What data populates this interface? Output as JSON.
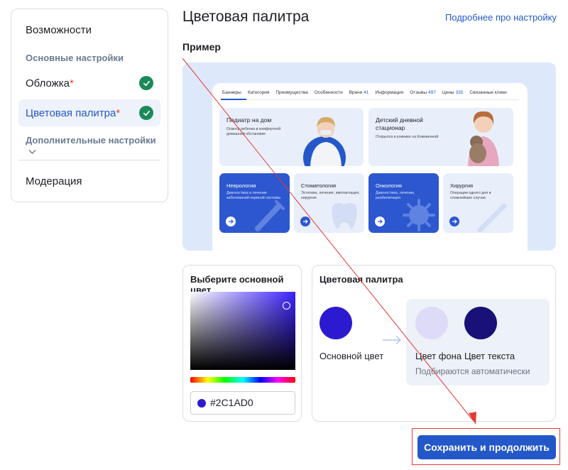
{
  "sidebar": {
    "features": "Возможности",
    "main_settings": "Основные настройки",
    "cover": "Обложка",
    "palette": "Цветовая палитра",
    "required_mark": "*",
    "additional": "Дополнительные настройки",
    "moderation": "Модерация"
  },
  "main": {
    "title": "Цветовая палитра",
    "more_link": "Подробнее про настройку",
    "example_heading": "Пример"
  },
  "preview": {
    "tabs": [
      {
        "label": "Баннеры",
        "count": ""
      },
      {
        "label": "Категория",
        "count": ""
      },
      {
        "label": "Преимущества",
        "count": ""
      },
      {
        "label": "Особенности",
        "count": ""
      },
      {
        "label": "Врачи",
        "count": "41"
      },
      {
        "label": "Информация",
        "count": ""
      },
      {
        "label": "Отзывы",
        "count": "497"
      },
      {
        "label": "Цены",
        "count": "335"
      },
      {
        "label": "Связанные клики",
        "count": ""
      }
    ],
    "banner1": {
      "title": "Педиатр на дом",
      "sub": "Осмотр ребенка в комфортной домашней обстановке"
    },
    "banner2": {
      "title": "Детский дневной стационар",
      "sub": "Открылся в клинике на Кожевенной"
    },
    "cards": [
      {
        "title": "Неврология",
        "sub": "Диагностика и лечение заболеваний нервной системы"
      },
      {
        "title": "Стоматология",
        "sub": "Эстетика, лечение, имплантация, хирургия"
      },
      {
        "title": "Онкология",
        "sub": "Диагностика, лечение, реабилитация"
      },
      {
        "title": "Хирургия",
        "sub": "Операции одного дня и сложнейшие случаи"
      }
    ]
  },
  "picker": {
    "heading": "Выберите основной цвет",
    "hex_value": "#2C1AD0"
  },
  "palette": {
    "heading": "Цветовая палитра",
    "primary_label": "Основной цвет",
    "bg_label": "Цвет фона",
    "text_label": "Цвет текста",
    "auto_note": "Подбираются автоматически"
  },
  "colors": {
    "primary": "#2c1ad0",
    "background": "#dedbf8",
    "text": "#171178",
    "accent": "#2458c9",
    "success": "#1b8a5a"
  },
  "actions": {
    "save_label": "Сохранить и продолжить"
  }
}
